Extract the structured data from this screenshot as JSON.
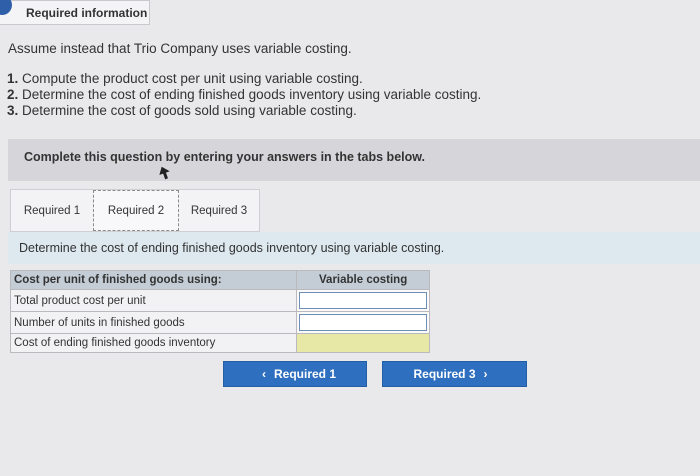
{
  "header": {
    "tab_label": "Required information"
  },
  "intro": "Assume instead that Trio Company uses variable costing.",
  "steps": [
    {
      "num": "1.",
      "text": "Compute the product cost per unit using variable costing."
    },
    {
      "num": "2.",
      "text": "Determine the cost of ending finished goods inventory using variable costing."
    },
    {
      "num": "3.",
      "text": "Determine the cost of goods sold using variable costing."
    }
  ],
  "complete_prompt": "Complete this question by entering your answers in the tabs below.",
  "tabs": [
    {
      "label": "Required 1"
    },
    {
      "label": "Required 2"
    },
    {
      "label": "Required 3"
    }
  ],
  "instruction": "Determine the cost of ending finished goods inventory using variable costing.",
  "table": {
    "header_left": "Cost per unit of finished goods using:",
    "header_right": "Variable costing",
    "rows": [
      {
        "label": "Total product cost per unit",
        "value": ""
      },
      {
        "label": "Number of units in finished goods",
        "value": ""
      },
      {
        "label": "Cost of ending finished goods inventory",
        "value": ""
      }
    ]
  },
  "nav": {
    "prev_label": "Required 1",
    "next_label": "Required 3",
    "prev_icon": "chevron-left-icon",
    "next_icon": "chevron-right-icon"
  },
  "colors": {
    "accent": "#2f6fbf",
    "instruction_bg": "#dde8ef",
    "total_cell": "#e8e8a6"
  }
}
